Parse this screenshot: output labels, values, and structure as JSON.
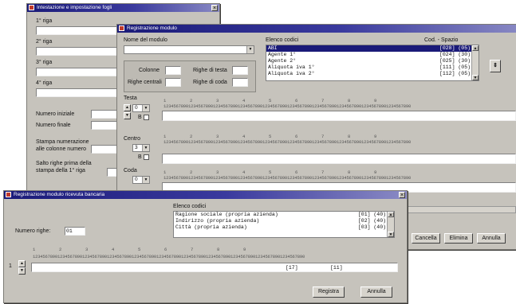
{
  "win1": {
    "title": "Intestazione e impostazione fogli",
    "riga1": "1° riga",
    "riga2": "2° riga",
    "riga3": "3° riga",
    "riga4": "4° riga",
    "numero_iniziale": "Numero iniziale",
    "numero_finale": "Numero finale",
    "stampa_num_1": "Stampa numerazione",
    "stampa_num_2": "alle colonne numero",
    "salto_1": "Salto righe prima della",
    "salto_2": "stampa della 1° riga"
  },
  "win2": {
    "title": "Registrazione modulo",
    "nome_modulo_label": "Nome del modulo",
    "elenco_codici_label": "Elenco codici",
    "cod_spazio_label": "Cod. - Spazio",
    "codes": [
      {
        "name": "ABI",
        "code": "[028] (05)",
        "selected": true
      },
      {
        "name": "Agente 1°",
        "code": "[024] (30)",
        "selected": false
      },
      {
        "name": "Agente 2°",
        "code": "[025] (30)",
        "selected": false
      },
      {
        "name": "Aliquota iva 1°",
        "code": "[111] (05)",
        "selected": false
      },
      {
        "name": "Aliquota iva 2°",
        "code": "[112] (05)",
        "selected": false
      }
    ],
    "colonne_label": "Colonne",
    "righe_testa_label": "Righe di testa",
    "righe_centrali_label": "Righe centrali",
    "righe_coda_label": "Righe di coda",
    "testa_label": "Testa",
    "centro_label": "Centro",
    "coda_label": "Coda",
    "testa_spin": "0",
    "centro_spin": "3",
    "coda_spin": "0",
    "b_label": "B",
    "cancel_label": "Cancella",
    "elimina_label": "Elimina",
    "annulla_label": "Annulla",
    "ruler_numbers": "1         2         3         4         5         6         7         8         9",
    "ruler_digits": "1234567890123456789012345678901234567890123456789012345678901234567890123456789012345678901234567890"
  },
  "win3": {
    "title": "Registrazione modulo ricevuta bancaria",
    "elenco_codici_label": "Elenco codici",
    "codes": [
      {
        "name": "Ragione sociale (propria azienda)",
        "code": "[01] (40)"
      },
      {
        "name": "Indirizzo (propria azienda)",
        "code": "[02] (40)"
      },
      {
        "name": "Città (propria azienda)",
        "code": "[03] (40)"
      }
    ],
    "numero_righe_label": "Numero righe:",
    "numero_righe_value": "01",
    "ruler_numbers": "1         2         3         4         5         6         7         8         9",
    "ruler_digits": "12345678901234567890123456789012345678901234567890123456789012345678901234567890123456789012345678901234567890",
    "row_number": "1",
    "field_marker_1": "[17]",
    "field_marker_2": "[11]",
    "registra_label": "Registra",
    "annulla_label": "Annulla"
  }
}
